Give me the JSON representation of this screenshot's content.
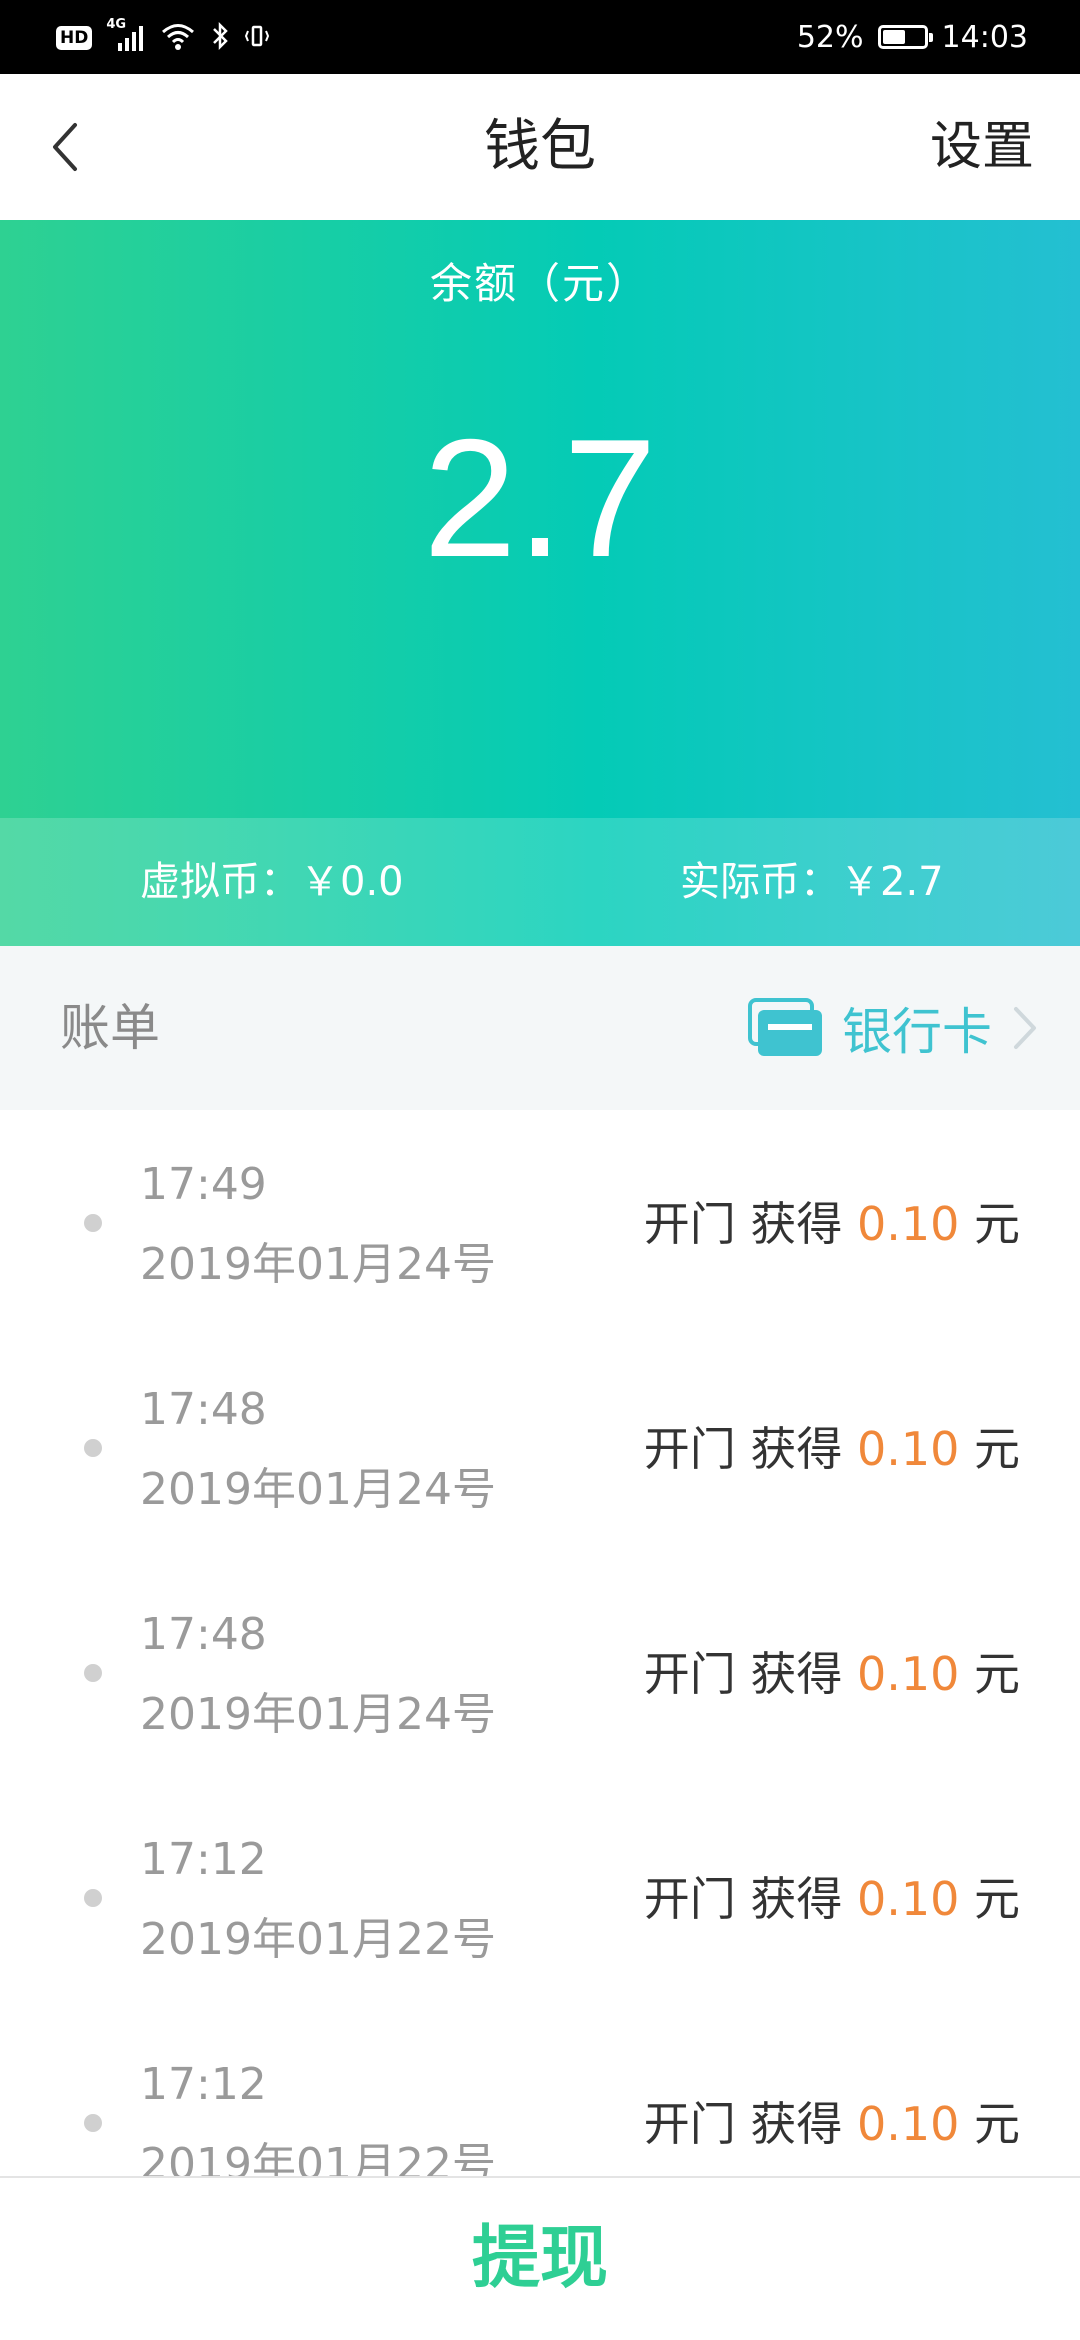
{
  "status_bar": {
    "hd": "HD",
    "network": "4G",
    "battery_percent": "52%",
    "battery_level": 0.52,
    "time": "14:03",
    "icons": [
      "signal-icon",
      "wifi-icon",
      "bluetooth-icon",
      "vibrate-icon",
      "battery-icon"
    ]
  },
  "header": {
    "title": "钱包",
    "settings_label": "设置",
    "back_icon": "chevron-left-icon"
  },
  "balance": {
    "label": "余额（元）",
    "amount": "2.7",
    "virtual_coin": "虚拟币：￥0.0",
    "real_coin": "实际币：￥2.7"
  },
  "bill": {
    "title": "账单",
    "bank_card_label": "银行卡",
    "bank_card_icon": "bank-card-icon"
  },
  "transactions": [
    {
      "time": "17:49",
      "date": "2019年01月24号",
      "action": "开门 获得",
      "amount": "0.10",
      "unit": "元"
    },
    {
      "time": "17:48",
      "date": "2019年01月24号",
      "action": "开门 获得",
      "amount": "0.10",
      "unit": "元"
    },
    {
      "time": "17:48",
      "date": "2019年01月24号",
      "action": "开门 获得",
      "amount": "0.10",
      "unit": "元"
    },
    {
      "time": "17:12",
      "date": "2019年01月22号",
      "action": "开门 获得",
      "amount": "0.10",
      "unit": "元"
    },
    {
      "time": "17:12",
      "date": "2019年01月22号",
      "action": "开门 获得",
      "amount": "0.10",
      "unit": "元"
    }
  ],
  "footer": {
    "withdraw_label": "提现"
  },
  "colors": {
    "accent_green": "#2ecf94",
    "accent_teal": "#3fc3d0",
    "amount_orange": "#f0883a"
  }
}
